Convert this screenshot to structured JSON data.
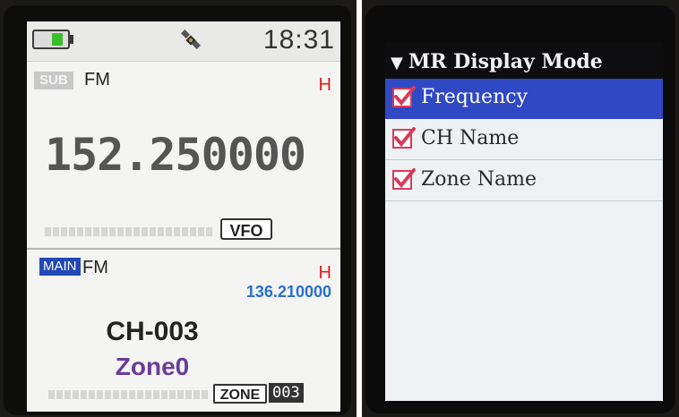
{
  "left_screen": {
    "status": {
      "time": "18:31",
      "battery_icon": "battery-icon",
      "satellite_icon": "satellite-icon"
    },
    "sub_band": {
      "badge": "SUB",
      "mode": "FM",
      "power": "H",
      "frequency": "152.250000",
      "vfo_label": "VFO"
    },
    "main_band": {
      "badge": "MAIN",
      "mode": "FM",
      "power": "H",
      "secondary_frequency": "136.210000",
      "channel": "CH-003",
      "zone": "Zone0",
      "zone_label": "ZONE",
      "zone_number": "003"
    }
  },
  "right_screen": {
    "menu_title": "MR Display Mode",
    "items": [
      {
        "label": "Frequency",
        "checked": true,
        "selected": true
      },
      {
        "label": "CH Name",
        "checked": true,
        "selected": false
      },
      {
        "label": "Zone Name",
        "checked": true,
        "selected": false
      }
    ]
  },
  "colors": {
    "selection_blue": "#2f48c4",
    "main_badge_blue": "#2048b8",
    "power_red": "#e02020",
    "freq_blue": "#2a6fd0",
    "zone_purple": "#6a3c98",
    "checkmark_red": "#d83b5a"
  }
}
